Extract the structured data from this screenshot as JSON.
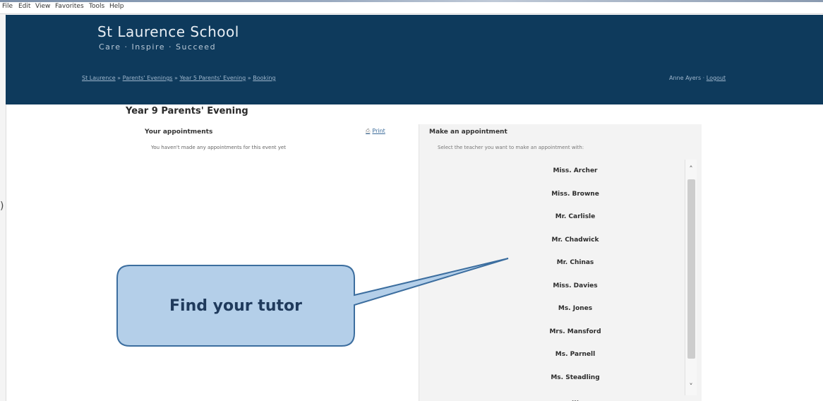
{
  "browser": {
    "menu": [
      "File",
      "Edit",
      "View",
      "Favorites",
      "Tools",
      "Help"
    ]
  },
  "header": {
    "school_name": "St Laurence School",
    "motto": "Care · Inspire · Succeed",
    "breadcrumb": [
      "St Laurence",
      "Parents' Evenings",
      "Year 5 Parents' Evening",
      "Booking"
    ],
    "user": "Anne Ayers",
    "logout": "Logout"
  },
  "page": {
    "title": "Year 9 Parents' Evening",
    "appointments_heading": "Your appointments",
    "appointments_empty": "You haven't made any appointments for this event yet",
    "print_label": "Print",
    "make_heading": "Make an appointment",
    "make_instruction": "Select the teacher you want to make an appointment with:",
    "teachers": [
      "Miss. Archer",
      "Miss. Browne",
      "Mr. Carlisle",
      "Mr. Chadwick",
      "Mr. Chinas",
      "Miss. Davies",
      "Ms. Jones",
      "Mrs. Mansford",
      "Ms. Parnell",
      "Ms. Steadling",
      "..."
    ]
  },
  "callout": {
    "text": "Find your tutor"
  },
  "colors": {
    "header_bg": "#0e3a5c",
    "callout_fill": "#b4cfe9",
    "callout_border": "#3c6e9f"
  }
}
